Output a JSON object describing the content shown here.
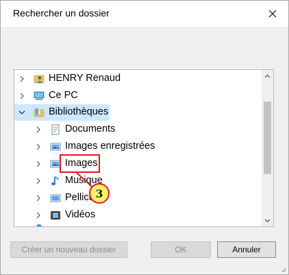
{
  "dialog": {
    "title": "Rechercher un dossier"
  },
  "tree": {
    "items": [
      {
        "label": "HENRY Renaud",
        "level": 0,
        "expanded": false,
        "icon": "user-folder-icon"
      },
      {
        "label": "Ce PC",
        "level": 0,
        "expanded": false,
        "icon": "computer-icon"
      },
      {
        "label": "Bibliothèques",
        "level": 0,
        "expanded": true,
        "selected": true,
        "icon": "library-icon"
      },
      {
        "label": "Documents",
        "level": 1,
        "expanded": false,
        "icon": "documents-library-icon"
      },
      {
        "label": "Images enregistrées",
        "level": 1,
        "expanded": false,
        "icon": "pictures-library-icon"
      },
      {
        "label": "Images",
        "level": 1,
        "expanded": false,
        "icon": "pictures-library-icon"
      },
      {
        "label": "Musique",
        "level": 1,
        "expanded": false,
        "icon": "music-library-icon"
      },
      {
        "label": "Pellicule",
        "level": 1,
        "expanded": false,
        "icon": "camera-roll-icon"
      },
      {
        "label": "Vidéos",
        "level": 1,
        "expanded": false,
        "icon": "videos-library-icon"
      }
    ]
  },
  "buttons": {
    "new_folder": "Créer un nouveau dossier",
    "ok": "OK",
    "cancel": "Annuler"
  },
  "annotation": {
    "step_number": "3",
    "color": "#e3141b",
    "badge_color": "#fdf36a"
  },
  "colors": {
    "selection": "#cce8ff",
    "dialog_bg": "#f0f0f0"
  }
}
